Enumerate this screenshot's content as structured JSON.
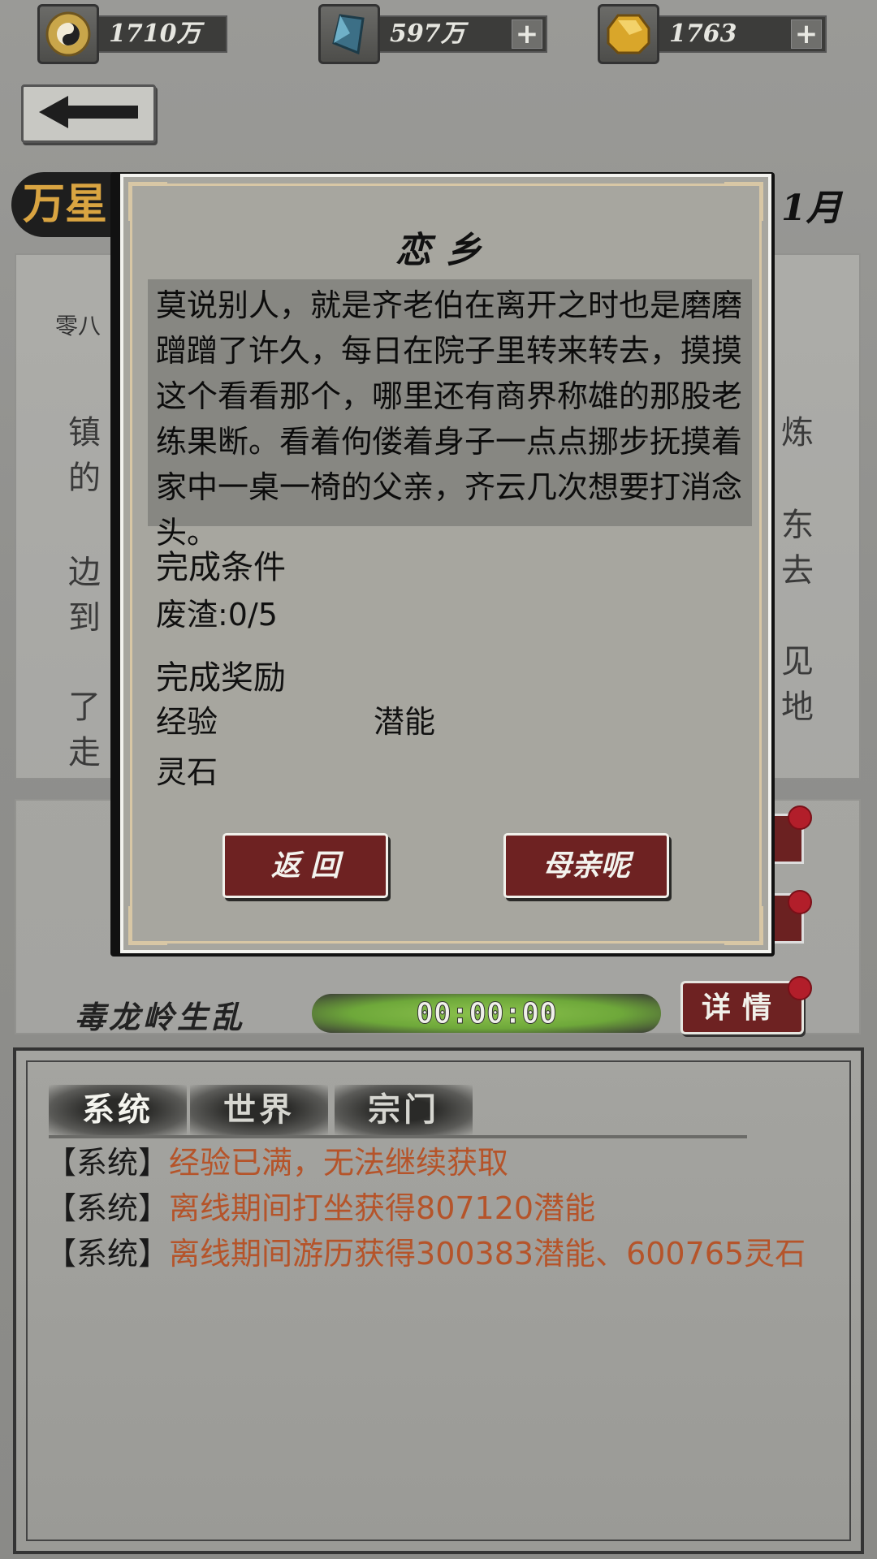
{
  "resources": [
    {
      "icon": "taiji-coin-icon",
      "value": "1710万",
      "has_plus": false
    },
    {
      "icon": "blue-crystal-icon",
      "value": "597万",
      "has_plus": true
    },
    {
      "icon": "gold-gem-icon",
      "value": "1763",
      "has_plus": true
    }
  ],
  "resource_plus_label": "+",
  "background": {
    "title": "万星",
    "month": "1月",
    "sub_label": "零八",
    "text_left": [
      "镇",
      "的",
      "边",
      "到",
      "了",
      "走"
    ],
    "text_right": [
      "炼",
      "东",
      "去",
      "见",
      "地"
    ],
    "event_name": "毒龙岭生乱",
    "timer": "00:00:00",
    "detail_button": "详情"
  },
  "dialog": {
    "title": "恋乡",
    "story": "莫说别人，就是齐老伯在离开之时也是磨磨蹭蹭了许久，每日在院子里转来转去，摸摸这个看看那个，哪里还有商界称雄的那股老练果断。看着佝偻着身子一点点挪步抚摸着家中一桌一椅的父亲，齐云几次想要打消念头。",
    "condition_label": "完成条件",
    "condition_value": "废渣:0/5",
    "reward_label": "完成奖励",
    "rewards": [
      "经验",
      "潜能",
      "灵石"
    ],
    "buttons": {
      "back": "返 回",
      "confirm": "母亲呢"
    }
  },
  "chat": {
    "tabs": [
      "系统",
      "世界",
      "宗门"
    ],
    "active_tab": "系统",
    "messages": [
      {
        "tag": "【系统】",
        "body": "经验已满，无法继续获取"
      },
      {
        "tag": "【系统】",
        "body": "离线期间打坐获得807120潜能"
      },
      {
        "tag": "【系统】",
        "body": "离线期间游历获得300383潜能、600765灵石"
      }
    ]
  },
  "colors": {
    "button_red": "#6e2222",
    "chat_highlight": "#b5542a",
    "notification_dot": "#b21e2a",
    "timer_green": "#8cc24d"
  }
}
